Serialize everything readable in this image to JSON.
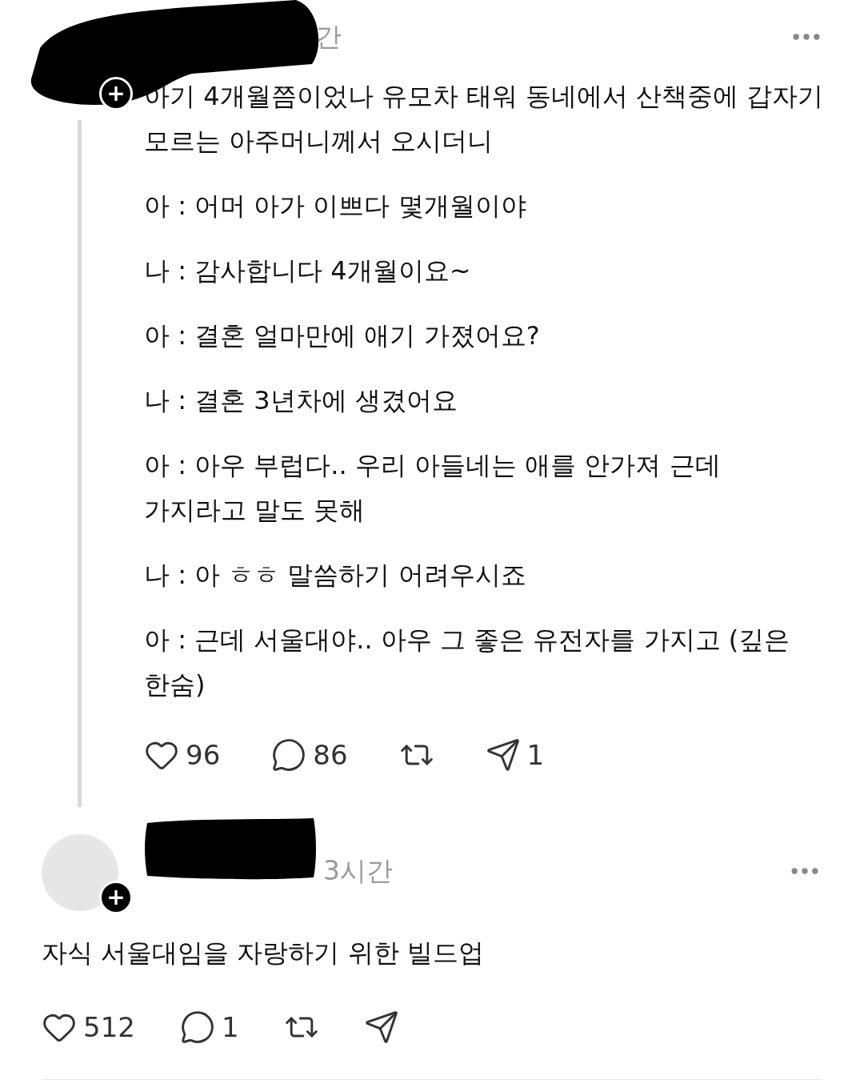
{
  "posts": [
    {
      "time": "간",
      "follow_badge": "+",
      "paragraphs": [
        "아기 4개월쯤이었나 유모차 태워 동네에서 산책중에 갑자기 모르는 아주머니께서 오시더니",
        "아 : 어머 아가 이쁘다 몇개월이야",
        "나 : 감사합니다 4개월이요~",
        "아 : 결혼 얼마만에 애기 가졌어요?",
        "나 : 결혼 3년차에 생겼어요",
        "아 : 아우 부럽다.. 우리 아들네는 애를 안가져 근데 가지라고 말도 못해",
        "나 : 아 ㅎㅎ 말씀하기 어려우시죠",
        "아 : 근데 서울대야.. 아우 그 좋은 유전자를 가지고 (깊은 한숨)"
      ],
      "actions": [
        {
          "kind": "like",
          "count": "96"
        },
        {
          "kind": "reply",
          "count": "86"
        },
        {
          "kind": "repost"
        },
        {
          "kind": "share",
          "count": "1"
        }
      ]
    },
    {
      "time": "3시간",
      "follow_badge": "+",
      "paragraphs": [
        "자식 서울대임을 자랑하기 위한 빌드업"
      ],
      "actions": [
        {
          "kind": "like",
          "count": "512"
        },
        {
          "kind": "reply",
          "count": "1"
        },
        {
          "kind": "repost"
        },
        {
          "kind": "share"
        }
      ]
    }
  ]
}
